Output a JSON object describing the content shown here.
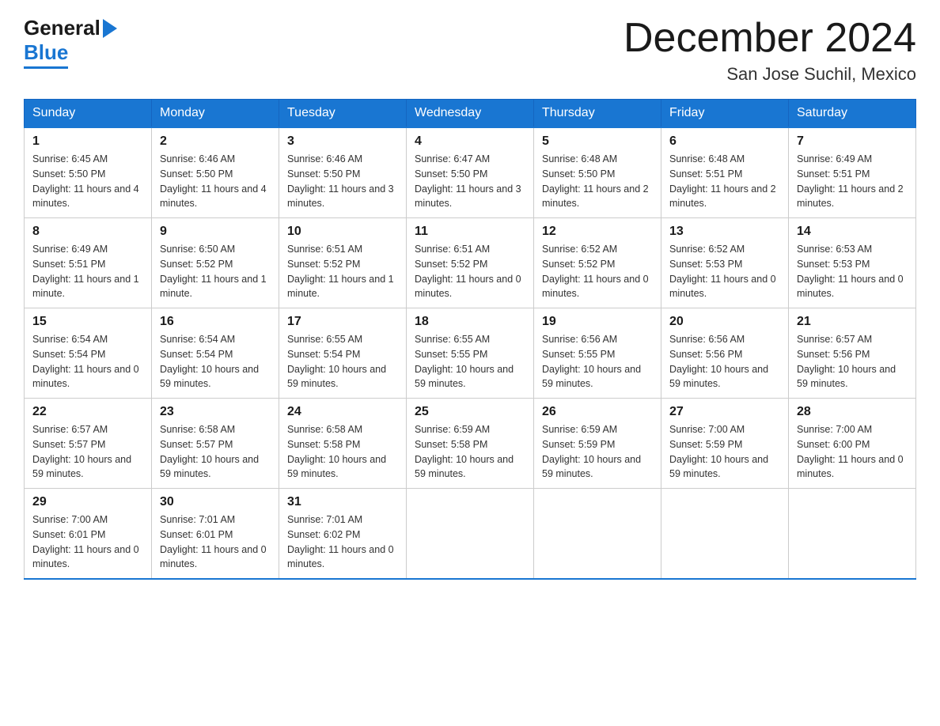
{
  "header": {
    "logo_general": "General",
    "logo_blue": "Blue",
    "month_title": "December 2024",
    "subtitle": "San Jose Suchil, Mexico"
  },
  "days_of_week": [
    "Sunday",
    "Monday",
    "Tuesday",
    "Wednesday",
    "Thursday",
    "Friday",
    "Saturday"
  ],
  "weeks": [
    [
      {
        "day": "1",
        "sunrise": "6:45 AM",
        "sunset": "5:50 PM",
        "daylight": "11 hours and 4 minutes."
      },
      {
        "day": "2",
        "sunrise": "6:46 AM",
        "sunset": "5:50 PM",
        "daylight": "11 hours and 4 minutes."
      },
      {
        "day": "3",
        "sunrise": "6:46 AM",
        "sunset": "5:50 PM",
        "daylight": "11 hours and 3 minutes."
      },
      {
        "day": "4",
        "sunrise": "6:47 AM",
        "sunset": "5:50 PM",
        "daylight": "11 hours and 3 minutes."
      },
      {
        "day": "5",
        "sunrise": "6:48 AM",
        "sunset": "5:50 PM",
        "daylight": "11 hours and 2 minutes."
      },
      {
        "day": "6",
        "sunrise": "6:48 AM",
        "sunset": "5:51 PM",
        "daylight": "11 hours and 2 minutes."
      },
      {
        "day": "7",
        "sunrise": "6:49 AM",
        "sunset": "5:51 PM",
        "daylight": "11 hours and 2 minutes."
      }
    ],
    [
      {
        "day": "8",
        "sunrise": "6:49 AM",
        "sunset": "5:51 PM",
        "daylight": "11 hours and 1 minute."
      },
      {
        "day": "9",
        "sunrise": "6:50 AM",
        "sunset": "5:52 PM",
        "daylight": "11 hours and 1 minute."
      },
      {
        "day": "10",
        "sunrise": "6:51 AM",
        "sunset": "5:52 PM",
        "daylight": "11 hours and 1 minute."
      },
      {
        "day": "11",
        "sunrise": "6:51 AM",
        "sunset": "5:52 PM",
        "daylight": "11 hours and 0 minutes."
      },
      {
        "day": "12",
        "sunrise": "6:52 AM",
        "sunset": "5:52 PM",
        "daylight": "11 hours and 0 minutes."
      },
      {
        "day": "13",
        "sunrise": "6:52 AM",
        "sunset": "5:53 PM",
        "daylight": "11 hours and 0 minutes."
      },
      {
        "day": "14",
        "sunrise": "6:53 AM",
        "sunset": "5:53 PM",
        "daylight": "11 hours and 0 minutes."
      }
    ],
    [
      {
        "day": "15",
        "sunrise": "6:54 AM",
        "sunset": "5:54 PM",
        "daylight": "11 hours and 0 minutes."
      },
      {
        "day": "16",
        "sunrise": "6:54 AM",
        "sunset": "5:54 PM",
        "daylight": "10 hours and 59 minutes."
      },
      {
        "day": "17",
        "sunrise": "6:55 AM",
        "sunset": "5:54 PM",
        "daylight": "10 hours and 59 minutes."
      },
      {
        "day": "18",
        "sunrise": "6:55 AM",
        "sunset": "5:55 PM",
        "daylight": "10 hours and 59 minutes."
      },
      {
        "day": "19",
        "sunrise": "6:56 AM",
        "sunset": "5:55 PM",
        "daylight": "10 hours and 59 minutes."
      },
      {
        "day": "20",
        "sunrise": "6:56 AM",
        "sunset": "5:56 PM",
        "daylight": "10 hours and 59 minutes."
      },
      {
        "day": "21",
        "sunrise": "6:57 AM",
        "sunset": "5:56 PM",
        "daylight": "10 hours and 59 minutes."
      }
    ],
    [
      {
        "day": "22",
        "sunrise": "6:57 AM",
        "sunset": "5:57 PM",
        "daylight": "10 hours and 59 minutes."
      },
      {
        "day": "23",
        "sunrise": "6:58 AM",
        "sunset": "5:57 PM",
        "daylight": "10 hours and 59 minutes."
      },
      {
        "day": "24",
        "sunrise": "6:58 AM",
        "sunset": "5:58 PM",
        "daylight": "10 hours and 59 minutes."
      },
      {
        "day": "25",
        "sunrise": "6:59 AM",
        "sunset": "5:58 PM",
        "daylight": "10 hours and 59 minutes."
      },
      {
        "day": "26",
        "sunrise": "6:59 AM",
        "sunset": "5:59 PM",
        "daylight": "10 hours and 59 minutes."
      },
      {
        "day": "27",
        "sunrise": "7:00 AM",
        "sunset": "5:59 PM",
        "daylight": "10 hours and 59 minutes."
      },
      {
        "day": "28",
        "sunrise": "7:00 AM",
        "sunset": "6:00 PM",
        "daylight": "11 hours and 0 minutes."
      }
    ],
    [
      {
        "day": "29",
        "sunrise": "7:00 AM",
        "sunset": "6:01 PM",
        "daylight": "11 hours and 0 minutes."
      },
      {
        "day": "30",
        "sunrise": "7:01 AM",
        "sunset": "6:01 PM",
        "daylight": "11 hours and 0 minutes."
      },
      {
        "day": "31",
        "sunrise": "7:01 AM",
        "sunset": "6:02 PM",
        "daylight": "11 hours and 0 minutes."
      },
      null,
      null,
      null,
      null
    ]
  ]
}
